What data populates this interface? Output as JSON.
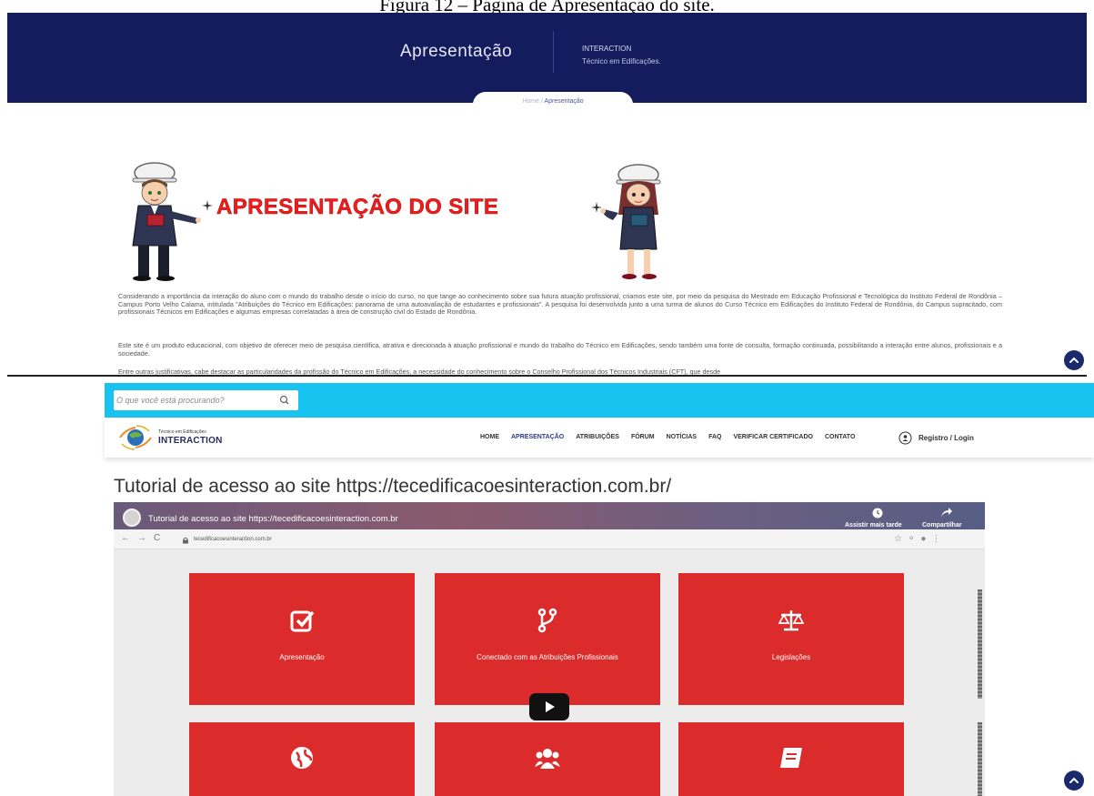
{
  "caption": "Figura 12 – Página de Apresentação do site.",
  "hero": {
    "title": "Apresentação",
    "brand": "INTERACTION",
    "subtitle": "Técnico em Edificações."
  },
  "breadcrumb": {
    "home": "Home",
    "sep": "/",
    "current": "Apresentação"
  },
  "banner_title": "APRESENTAÇÃO DO SITE",
  "paragraphs": [
    "Considerando a importância da interação do aluno com o mundo do trabalho desde o início do curso, no que tange ao conhecimento sobre sua futura atuação profissional, criamos este site, por meio da pesquisa do Mestrado em Educação Profissional e Tecnológica do Instituto Federal de Rondônia – Campus Porto Velho Calama, intitulada \"Atribuições do Técnico em Edificações: panorama de uma autoavaliação de estudantes e profissionais\". A pesquisa foi desenvolvida junto a uma turma de alunos do Curso Técnico em Edificações do Instituto Federal de Rondônia, do Campus supracitado, com profissionais Técnicos em Edificações e algumas empresas correlatadas à área de construção civil do Estado de Rondônia.",
    "Este site é um produto educacional, com objetivo de oferecer meio de pesquisa científica, atrativa e direcionada à atuação profissional e mundo do trabalho do Técnico em Edificações, sendo também uma fonte de consulta, formação continuada, possibilitando a interação entre alunos, profissionais e a sociedade.",
    "Entre outras justificativas, cabe destacar as particularidades da profissão do Técnico em Edificações, a necessidade do conhecimento sobre o Conselho Profissional dos Técnicos Industriais (CFT), que desde"
  ],
  "search": {
    "placeholder": "O que você está procurando?"
  },
  "logo": {
    "small": "Técnico em Edificações",
    "big": "INTERACTION"
  },
  "nav": [
    "HOME",
    "APRESENTAÇÃO",
    "ATRIBUIÇÕES",
    "FÓRUM",
    "NOTÍCIAS",
    "FAQ",
    "VERIFICAR CERTIFICADO",
    "CONTATO"
  ],
  "login_label": "Registro / Login",
  "tutorial_title": "Tutorial de acesso ao site https://tecedificacoesinteraction.com.br/",
  "video": {
    "title": "Tutorial de acesso ao site https://tecedificacoesinteraction.com.br",
    "watch_later": "Assistir mais tarde",
    "share": "Compartilhar",
    "url": "tecedificacoesinteraction.com.br",
    "tiles": [
      "Apresentação",
      "Conectado com as Atribuições Profissionais",
      "Legislações"
    ]
  },
  "colors": {
    "navy": "#141c5e",
    "cyan": "#19c3ef",
    "tile_red": "#db2b2b",
    "banner_red": "#ee1c1c",
    "fab": "#1a2a6c"
  }
}
